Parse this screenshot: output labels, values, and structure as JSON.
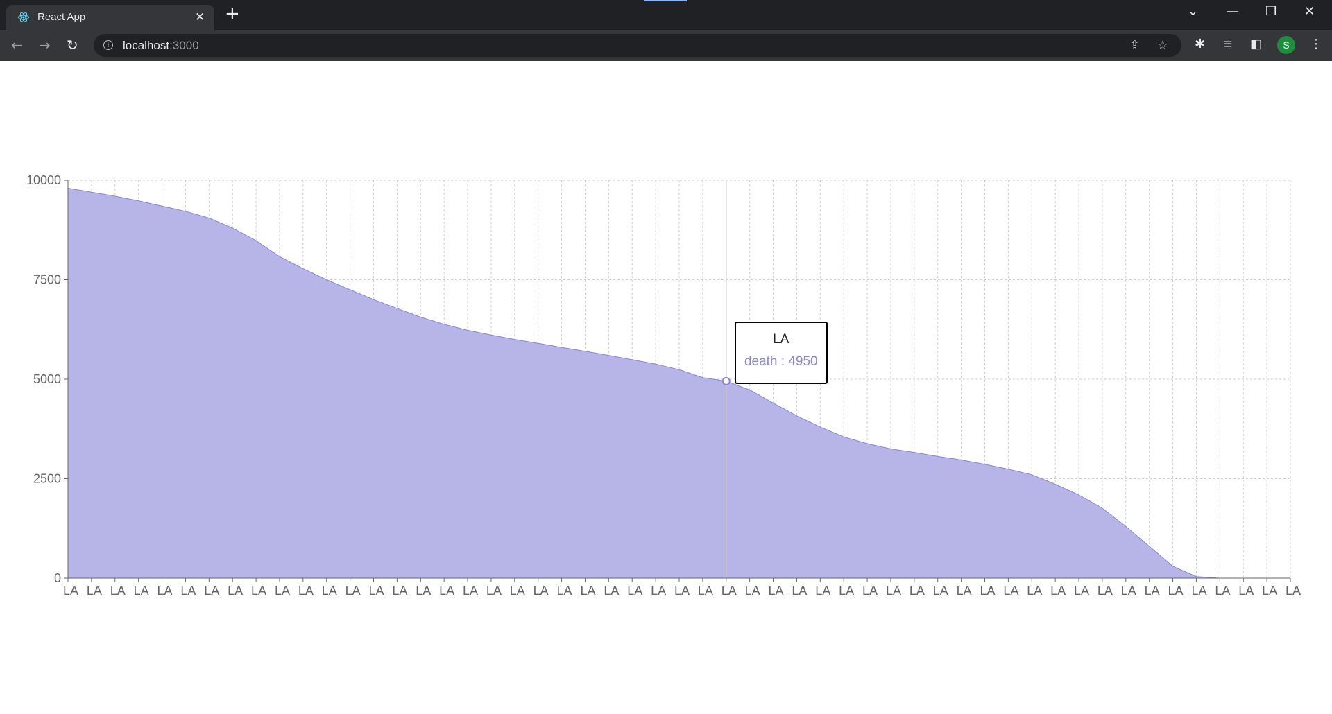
{
  "browser": {
    "tab_title": "React App",
    "tab_close_icon": "close-icon",
    "url_host": "localhost",
    "url_port": ":3000",
    "profile_initial": "S"
  },
  "colors": {
    "area_fill": "#b7b4e8",
    "area_stroke": "#8884d8",
    "grid": "#cccccc"
  },
  "chart_data": {
    "type": "area",
    "x_category_label": "LA",
    "yticks": [
      0,
      2500,
      5000,
      7500,
      10000
    ],
    "ylim": [
      0,
      10000
    ],
    "grid": true,
    "series": [
      {
        "name": "death",
        "values": [
          9800,
          9700,
          9600,
          9480,
          9350,
          9220,
          9050,
          8800,
          8480,
          8080,
          7780,
          7500,
          7250,
          7000,
          6780,
          6560,
          6380,
          6230,
          6110,
          6000,
          5900,
          5800,
          5700,
          5600,
          5490,
          5380,
          5240,
          5040,
          4950,
          4730,
          4400,
          4080,
          3800,
          3550,
          3380,
          3250,
          3160,
          3060,
          2970,
          2860,
          2740,
          2600,
          2360,
          2090,
          1760,
          1300,
          800,
          300,
          40,
          0,
          0,
          0,
          0
        ]
      }
    ],
    "tooltip": {
      "label": "LA",
      "series": "death",
      "value": 4950,
      "text": "death : 4950"
    }
  }
}
